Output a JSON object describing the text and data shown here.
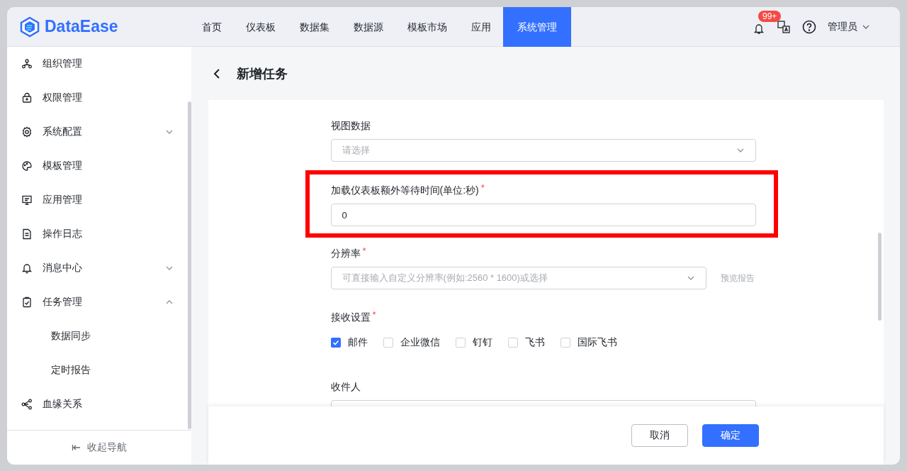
{
  "header": {
    "logo": "DataEase",
    "nav": [
      {
        "label": "首页",
        "selected": false
      },
      {
        "label": "仪表板",
        "selected": false
      },
      {
        "label": "数据集",
        "selected": false
      },
      {
        "label": "数据源",
        "selected": false
      },
      {
        "label": "模板市场",
        "selected": false
      },
      {
        "label": "应用",
        "selected": false
      },
      {
        "label": "系统管理",
        "selected": true
      }
    ],
    "notification_badge": "99+",
    "user": "管理员"
  },
  "sidebar": {
    "items": [
      {
        "label": "组织管理"
      },
      {
        "label": "权限管理"
      },
      {
        "label": "系统配置",
        "expanded": false
      },
      {
        "label": "模板管理"
      },
      {
        "label": "应用管理"
      },
      {
        "label": "操作日志"
      },
      {
        "label": "消息中心",
        "expanded": false
      },
      {
        "label": "任务管理",
        "expanded": true,
        "children": [
          {
            "label": "数据同步"
          },
          {
            "label": "定时报告"
          }
        ]
      },
      {
        "label": "血缘关系"
      }
    ],
    "collapse": "收起导航"
  },
  "page": {
    "title": "新增任务",
    "fields": [
      {
        "kind": "select",
        "label": "视图数据",
        "placeholder": "请选择"
      },
      {
        "kind": "input",
        "label": "加载仪表板额外等待时间(单位:秒)",
        "required_mark": "*",
        "value": "0",
        "highlighted": true
      },
      {
        "kind": "select",
        "label": "分辨率",
        "required_mark": "*",
        "placeholder": "可直接输入自定义分辨率(例如:2560  *  1600)或选择",
        "side_link": "预览报告"
      },
      {
        "kind": "checks",
        "label": "接收设置",
        "required_mark": "*",
        "options": [
          {
            "label": "邮件",
            "checked": true
          },
          {
            "label": "企业微信",
            "checked": false
          },
          {
            "label": "钉钉",
            "checked": false
          },
          {
            "label": "飞书",
            "checked": false
          },
          {
            "label": "国际飞书",
            "checked": false
          }
        ]
      },
      {
        "kind": "select_cut",
        "label": "收件人"
      }
    ],
    "buttons": [
      {
        "label": "取消",
        "kind": "secondary"
      },
      {
        "label": "确定",
        "kind": "primary"
      }
    ]
  }
}
